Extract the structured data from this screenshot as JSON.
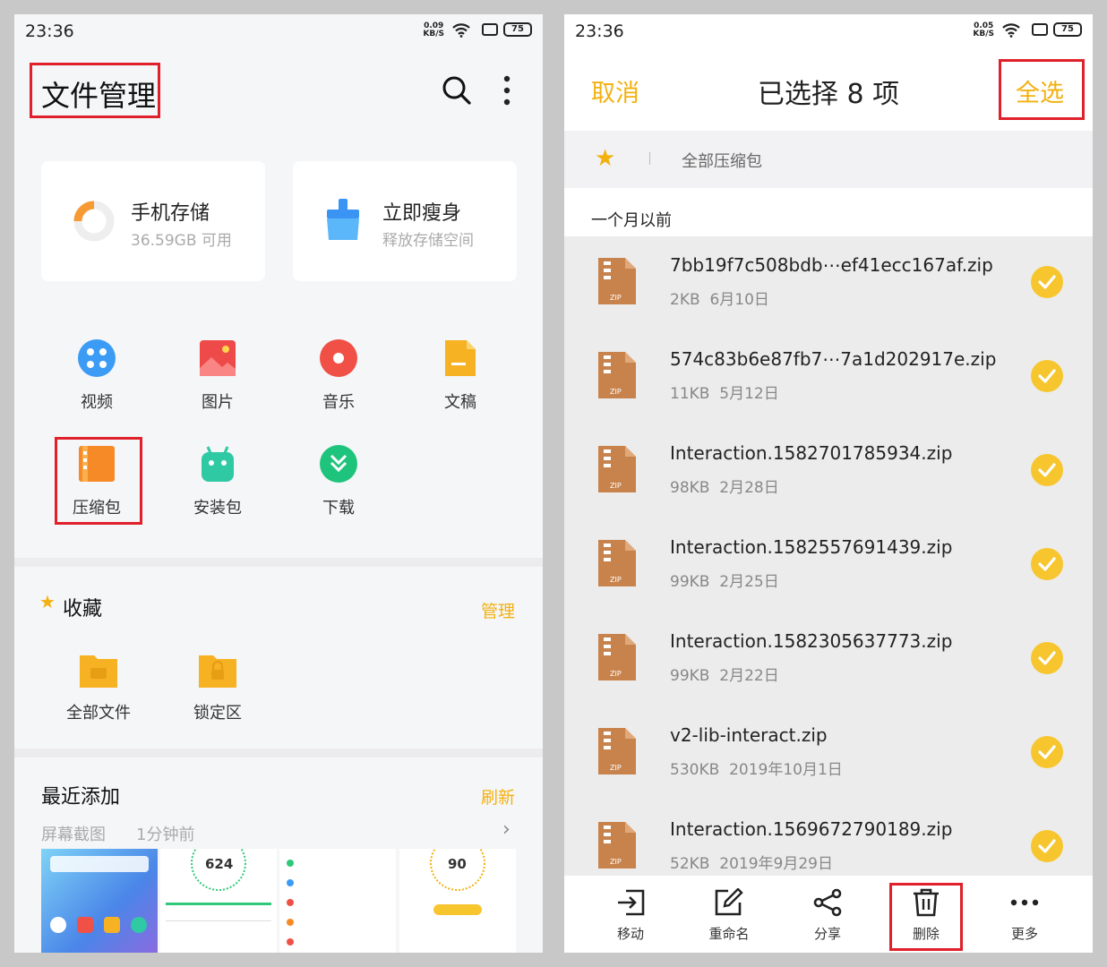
{
  "left": {
    "status": {
      "time": "23:36",
      "speed_value": "0.09",
      "speed_unit": "KB/S",
      "battery": "75"
    },
    "title": "文件管理",
    "storage_card": {
      "title": "手机存储",
      "subtitle": "36.59GB 可用"
    },
    "clean_card": {
      "title": "立即瘦身",
      "subtitle": "释放存储空间"
    },
    "categories": [
      {
        "label": "视频",
        "icon": "video-icon",
        "color": "#3c9cf5"
      },
      {
        "label": "图片",
        "icon": "image-icon",
        "color": "#ef4a4a"
      },
      {
        "label": "音乐",
        "icon": "music-icon",
        "color": "#f05046"
      },
      {
        "label": "文稿",
        "icon": "document-icon",
        "color": "#f7b224"
      },
      {
        "label": "压缩包",
        "icon": "archive-icon",
        "color": "#f68a26"
      },
      {
        "label": "安装包",
        "icon": "android-icon",
        "color": "#2fc9a4"
      },
      {
        "label": "下载",
        "icon": "download-icon",
        "color": "#1fc47c"
      }
    ],
    "favorites": {
      "title": "收藏",
      "manage_label": "管理",
      "items": [
        {
          "label": "全部文件",
          "icon": "folder-icon"
        },
        {
          "label": "锁定区",
          "icon": "locked-folder-icon"
        }
      ]
    },
    "recent": {
      "title": "最近添加",
      "refresh_label": "刷新",
      "source": "屏幕截图",
      "time": "1分钟前",
      "thumb_values": [
        "624",
        "90"
      ]
    }
  },
  "right": {
    "status": {
      "time": "23:36",
      "speed_value": "0.05",
      "speed_unit": "KB/S",
      "battery": "75"
    },
    "cancel_label": "取消",
    "selection_title": "已选择 8 项",
    "select_all_label": "全选",
    "breadcrumb": "全部压缩包",
    "group_label": "一个月以前",
    "files": [
      {
        "name": "7bb19f7c508bdb⋯ef41ecc167af.zip",
        "size": "2KB",
        "date": "6月10日"
      },
      {
        "name": "574c83b6e87fb7⋯7a1d202917e.zip",
        "size": "11KB",
        "date": "5月12日"
      },
      {
        "name": "Interaction.1582701785934.zip",
        "size": "98KB",
        "date": "2月28日"
      },
      {
        "name": "Interaction.1582557691439.zip",
        "size": "99KB",
        "date": "2月25日"
      },
      {
        "name": "Interaction.1582305637773.zip",
        "size": "99KB",
        "date": "2月22日"
      },
      {
        "name": "v2-lib-interact.zip",
        "size": "530KB",
        "date": "2019年10月1日"
      },
      {
        "name": "Interaction.1569672790189.zip",
        "size": "52KB",
        "date": "2019年9月29日"
      }
    ],
    "zip_label": "ZIP",
    "toolbar": [
      {
        "label": "移动",
        "icon": "move-icon"
      },
      {
        "label": "重命名",
        "icon": "rename-icon"
      },
      {
        "label": "分享",
        "icon": "share-icon"
      },
      {
        "label": "删除",
        "icon": "delete-icon"
      },
      {
        "label": "更多",
        "icon": "more-icon"
      }
    ],
    "accent": "#f3b10f",
    "highlight": "#e0202a"
  }
}
